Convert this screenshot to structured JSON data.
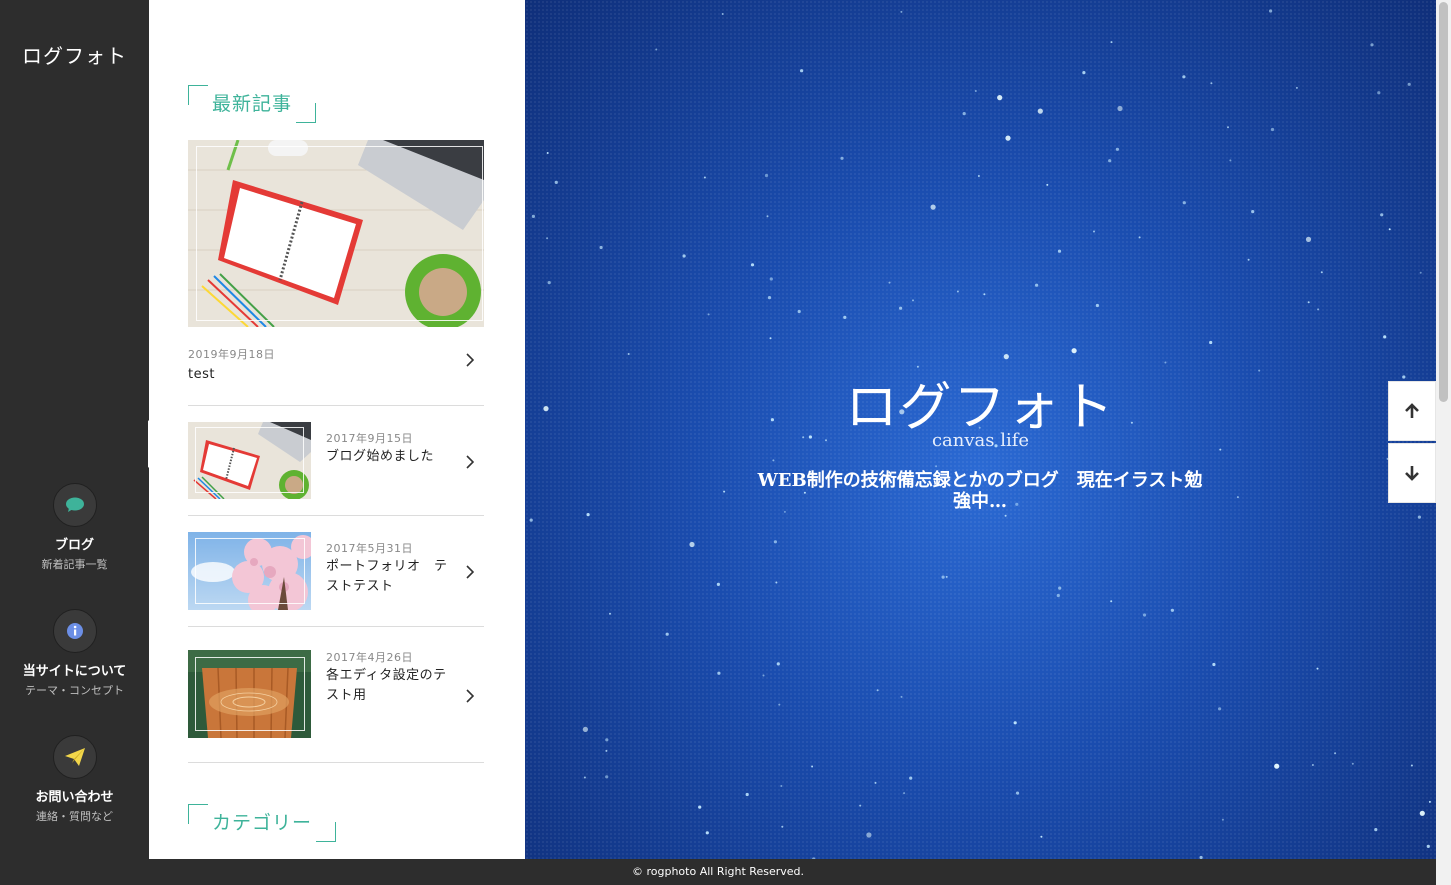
{
  "site": {
    "logo": "ログフォト"
  },
  "nav": [
    {
      "label": "ブログ",
      "sub": "新着記事一覧",
      "icon": "speech-bubble-icon"
    },
    {
      "label": "当サイトについて",
      "sub": "テーマ・コンセプト",
      "icon": "info-icon"
    },
    {
      "label": "お問い合わせ",
      "sub": "連絡・質問など",
      "icon": "paper-plane-icon"
    }
  ],
  "panel": {
    "latest_heading": "最新記事",
    "category_heading": "カテゴリー",
    "featured": {
      "date": "2019年9月18日",
      "title": "test"
    },
    "posts": [
      {
        "date": "2017年9月15日",
        "title": "ブログ始めました"
      },
      {
        "date": "2017年5月31日",
        "title": "ポートフォリオ　テストテスト"
      },
      {
        "date": "2017年4月26日",
        "title": "各エディタ設定のテスト用"
      }
    ]
  },
  "hero": {
    "title": "ログフォト",
    "subtitle": "canvas life",
    "description": "WEB制作の技術備忘録とかのブログ　現在イラスト勉強中…"
  },
  "footer": {
    "copyright": "© rogphoto All Right Reserved."
  },
  "colors": {
    "accent": "#3eb39a",
    "sidebar": "#2d2d2d",
    "hero": "#1a4cae"
  }
}
